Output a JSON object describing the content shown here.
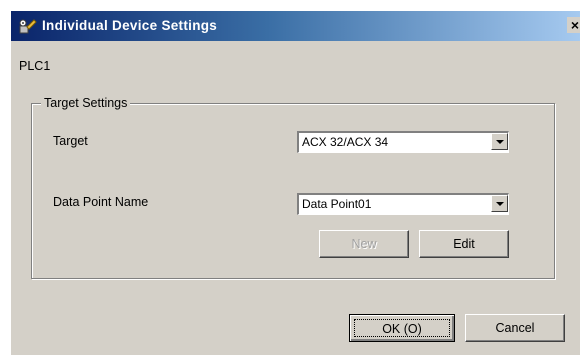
{
  "window": {
    "title": "Individual Device Settings",
    "close_label": "×",
    "device_name": "PLC1"
  },
  "group": {
    "legend": "Target Settings",
    "target_label": "Target",
    "target_value": "ACX 32/ACX 34",
    "data_point_label": "Data Point Name",
    "data_point_value": "Data Point01",
    "new_label": "New",
    "edit_label": "Edit"
  },
  "footer": {
    "ok_label": "OK (O)",
    "cancel_label": "Cancel"
  },
  "icons": {
    "title_icon": "settings-tool-icon",
    "dropdown_icon": "chevron-down-icon"
  }
}
